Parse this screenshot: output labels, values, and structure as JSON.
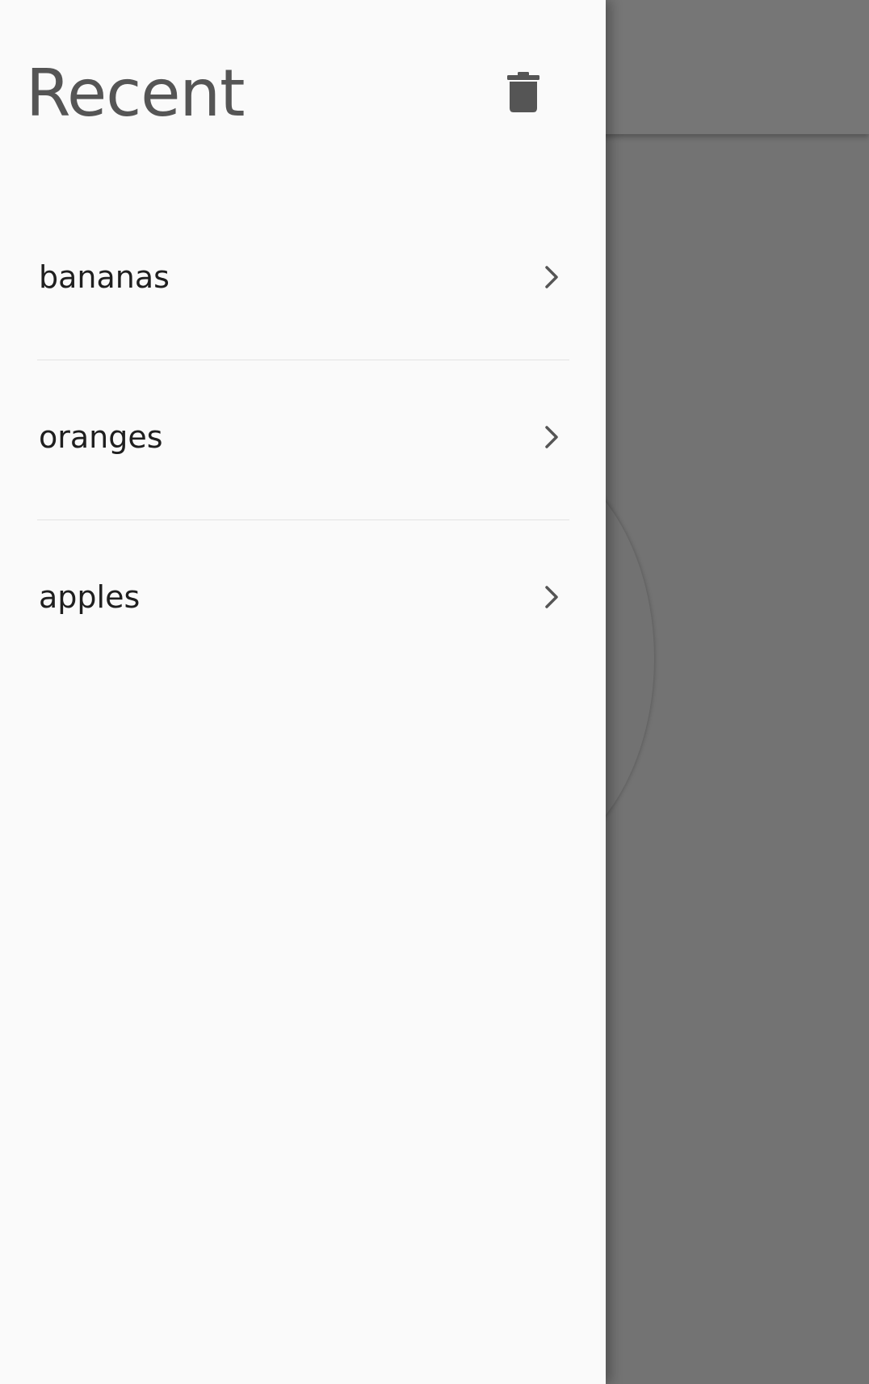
{
  "drawer": {
    "title": "Recent",
    "delete_icon": "trash-icon"
  },
  "recent_items": [
    {
      "label": "bananas",
      "icon": "chevron-right-icon"
    },
    {
      "label": "oranges",
      "icon": "chevron-right-icon"
    },
    {
      "label": "apples",
      "icon": "chevron-right-icon"
    }
  ],
  "colors": {
    "drawer_background": "#fafafa",
    "title": "#555555",
    "item_text": "#1f1f1f",
    "icon": "#555555",
    "divider": "#e2e2e2",
    "scrim_background": "#737373"
  }
}
